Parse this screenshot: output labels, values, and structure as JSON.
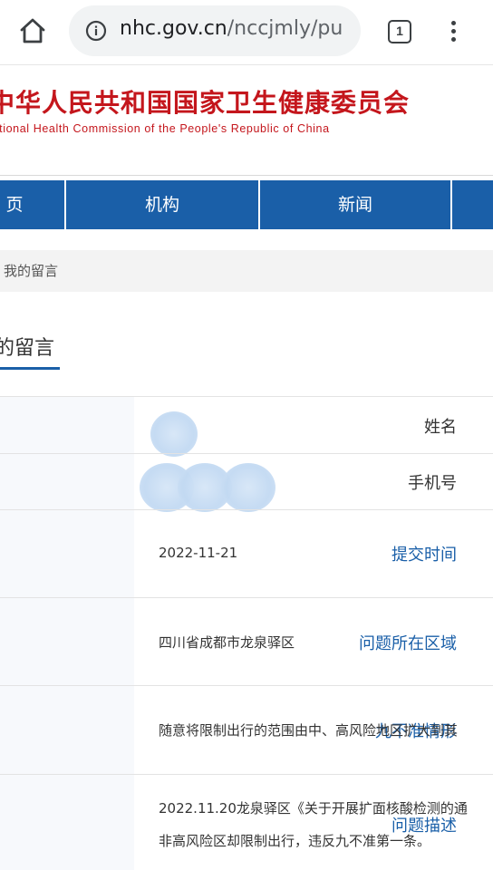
{
  "browser": {
    "url_host": "nhc.gov.cn",
    "url_path": "/nccjmly/pu",
    "tab_count": "1"
  },
  "site": {
    "title_cn": "中华人民共和国国家卫生健康委员会",
    "title_en": "National Health Commission of the People's Republic of China"
  },
  "nav": {
    "items": [
      "页",
      "机构",
      "新闻"
    ]
  },
  "breadcrumb": "我的留言",
  "page_heading": "的留言",
  "details": {
    "name_label": "姓名",
    "phone_label": "手机号",
    "submit_time_label": "提交时间",
    "submit_time_value": "2022-11-21",
    "region_label": "问题所在区域",
    "region_value": "四川省成都市龙泉驿区",
    "nine_label": "九不准情形",
    "nine_value": "随意将限制出行的范围由中、高风险地区扩大到其",
    "desc_label": "问题描述",
    "desc_line1": "2022.11.20龙泉驿区《关于开展扩面核酸检测的通",
    "desc_line2": "非高风险区却限制出行，违反九不准第一条。"
  },
  "colors": {
    "brand_red": "#c4161c",
    "nav_blue": "#1a5fa8"
  },
  "icons": [
    "home-icon",
    "info-icon",
    "tabs-icon",
    "more-vert-icon"
  ]
}
